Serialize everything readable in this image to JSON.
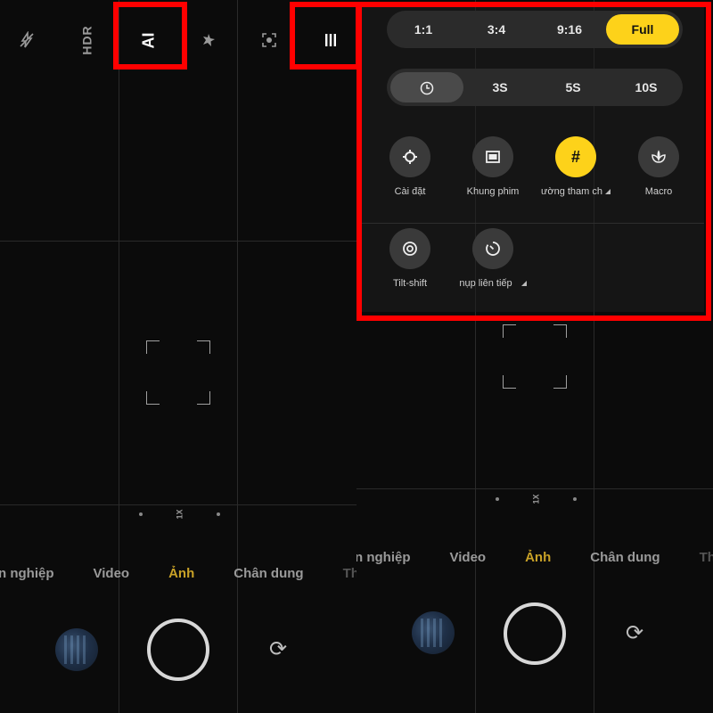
{
  "left": {
    "top_icons": [
      "flash-off-icon",
      "HDR",
      "AI",
      "magic-icon",
      "face-scan-icon",
      "menu-icon"
    ],
    "hdr_label": "HDR",
    "ai_label": "AI",
    "menu_glyph": "|||",
    "zoom_label": "1X",
    "modes": [
      "n nghiệp",
      "Video",
      "Ảnh",
      "Chân dung",
      "Th"
    ],
    "active_mode": "Ảnh"
  },
  "right": {
    "zoom_label": "1X",
    "modes": [
      "n nghiệp",
      "Video",
      "Ảnh",
      "Chân dung",
      "Th"
    ],
    "active_mode": "Ảnh"
  },
  "settings_popup": {
    "aspect_ratios": [
      "1:1",
      "3:4",
      "9:16",
      "Full"
    ],
    "selected_aspect": "Full",
    "timer_options": [
      "timer-icon",
      "3S",
      "5S",
      "10S"
    ],
    "selected_timer": "timer-icon",
    "tiles": [
      {
        "label": "Cài đặt",
        "icon": "settings-icon",
        "active": false,
        "submenu": false
      },
      {
        "label": "Khung phim",
        "icon": "frame-icon",
        "active": false,
        "submenu": false
      },
      {
        "label": "ường tham ch",
        "icon": "grid-icon",
        "active": true,
        "submenu": true
      },
      {
        "label": "Macro",
        "icon": "macro-icon",
        "active": false,
        "submenu": false
      },
      {
        "label": "Tilt-shift",
        "icon": "tilt-shift-icon",
        "active": false,
        "submenu": false
      },
      {
        "label": "nụp liên tiếp",
        "icon": "burst-timer-icon",
        "active": false,
        "submenu": true
      }
    ]
  },
  "colors": {
    "accent_yellow": "#fdd21a",
    "active_mode_gold": "#c9a227",
    "highlight_red": "#ff0000"
  }
}
